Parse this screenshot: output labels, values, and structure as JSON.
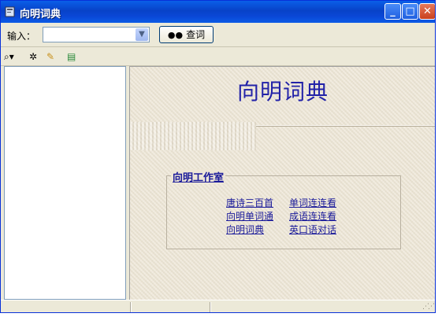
{
  "window": {
    "title": "向明词典"
  },
  "search": {
    "label": "输入：",
    "value": "",
    "query_button": "查词"
  },
  "main": {
    "title": "向明词典",
    "group_label": "向明工作室",
    "links": [
      "唐诗三百首",
      "单词连连看",
      "向明单词通",
      "成语连连看",
      "向明词典",
      "英口语对话"
    ]
  },
  "colors": {
    "title_blue": "#2222a8",
    "link_blue": "#1a1a9a",
    "titlebar": "#0a5fe8"
  }
}
